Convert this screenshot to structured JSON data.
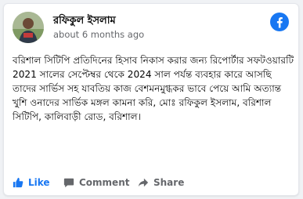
{
  "post": {
    "author_name": "রফিকুল ইসলাম",
    "timestamp": "about 6 months ago",
    "body": "বরিশাল সিটিপি প্রতিদিনের হিসাব নিকাস করার জন্য রিপোর্টার সফটওয়ারটি 2021 সালের সেপ্টেম্বর থেকে 2024 সাল পর্যন্ত ব্যবহার কারে আসছি তাদের সার্ভিস সহ যাবতিয় কাজ বেশমনমুগ্ধকর ভাবে পেয়ে আমি অত্যান্ত খুশি ওনাদের সার্ভিক মঙ্গল কামনা করি, মোঃ রফিকুল ইসলাম, বরিশাল সিটিপি, কালিবাড়ী রোড, বরিশাল।"
  },
  "actions": {
    "like_label": "Like",
    "comment_label": "Comment",
    "share_label": "Share"
  },
  "colors": {
    "facebook_blue": "#1877f2",
    "muted_text": "#65676b"
  },
  "icons": {
    "logo": "facebook-logo-icon",
    "like": "thumbs-up-icon",
    "comment": "speech-bubble-icon",
    "share": "share-arrow-icon"
  }
}
